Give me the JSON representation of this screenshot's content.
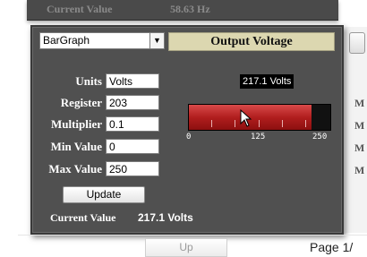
{
  "background_panel": {
    "label": "Current Value",
    "value": "58.63 Hz"
  },
  "widget": {
    "type_select": {
      "value": "BarGraph"
    },
    "title": "Output Voltage",
    "fields": [
      {
        "label": "Units",
        "value": "Volts"
      },
      {
        "label": "Register",
        "value": "203"
      },
      {
        "label": "Multiplier",
        "value": "0.1"
      },
      {
        "label": "Min Value",
        "value": "0"
      },
      {
        "label": "Max Value",
        "value": "250"
      }
    ],
    "update_button": "Update",
    "current_value_label": "Current Value",
    "current_value": "217.1 Volts"
  },
  "gauge": {
    "readout": "217.1 Volts",
    "min": 0,
    "max": 250,
    "value": 217.1,
    "tick_labels": [
      "0",
      "125",
      "250"
    ],
    "fill_color": "#b11e1e"
  },
  "right_panel": {
    "letters": [
      "M",
      "M",
      "M",
      "M"
    ]
  },
  "footer": {
    "up_button": "Up",
    "page_label": "Page 1/"
  }
}
